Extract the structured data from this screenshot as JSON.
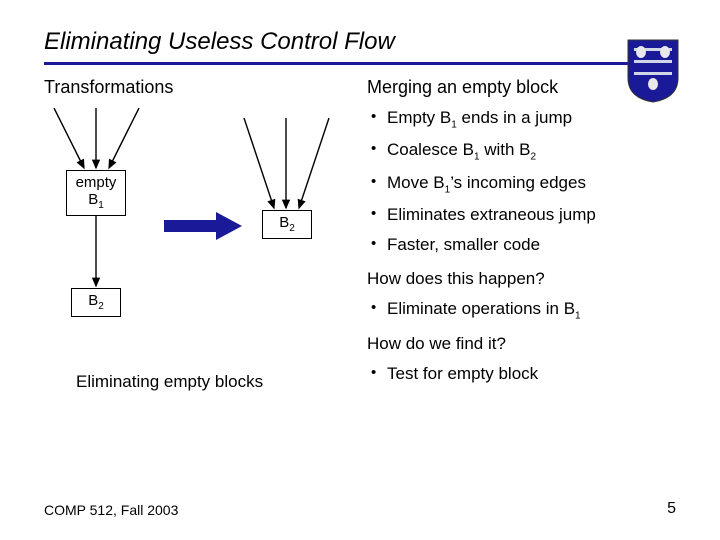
{
  "title": "Eliminating Useless Control Flow",
  "left": {
    "heading": "Transformations",
    "b1_label_line1": "empty",
    "b1_label_line2_base": "B",
    "b1_label_line2_sub": "1",
    "b2_left_base": "B",
    "b2_left_sub": "2",
    "b2_right_base": "B",
    "b2_right_sub": "2",
    "caption": "Eliminating empty blocks"
  },
  "right": {
    "heading": "Merging an empty block",
    "bullets": [
      {
        "pre": "Empty B",
        "sub": "1",
        "post": " ends in a jump"
      },
      {
        "pre": "Coalesce B",
        "sub": "1",
        "post": " with B",
        "sub2_base": "",
        "sub2": "2"
      },
      {
        "pre": "Move B",
        "sub": "1",
        "post": "’s incoming edges"
      },
      {
        "pre": "Eliminates extraneous jump",
        "sub": "",
        "post": ""
      },
      {
        "pre": "Faster, smaller code",
        "sub": "",
        "post": ""
      }
    ],
    "q1": "How does this happen?",
    "q1_bullet_pre": "Eliminate operations in B",
    "q1_bullet_sub": "1",
    "q2": "How do we find it?",
    "q2_bullet": "Test for empty block"
  },
  "footer": {
    "left": "COMP 512, Fall 2003",
    "right": "5"
  }
}
